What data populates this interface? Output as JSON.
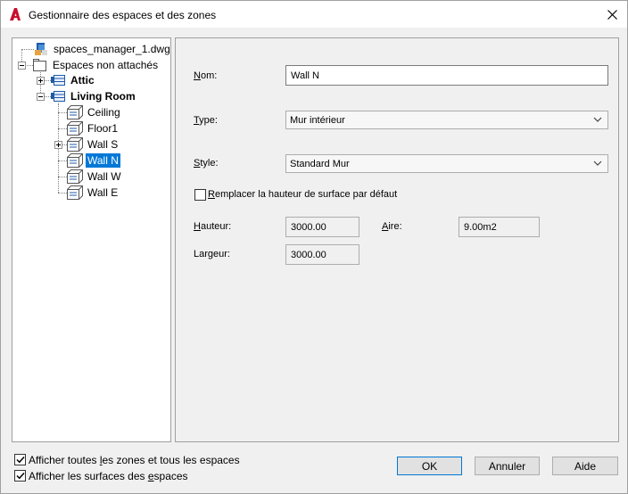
{
  "window": {
    "title": "Gestionnaire des espaces et des zones"
  },
  "tree": {
    "root": "spaces_manager_1.dwg",
    "group": "Espaces non attachés",
    "zones": [
      "Attic",
      "Living Room"
    ],
    "surfaces": [
      "Ceiling",
      "Floor1",
      "Wall S",
      "Wall N",
      "Wall W",
      "Wall E"
    ],
    "selected": "Wall N"
  },
  "form": {
    "name_label": "om:",
    "name_label_accel": "N",
    "name_value": "Wall N",
    "type_label": "ype:",
    "type_label_accel": "T",
    "type_value": "Mur intérieur",
    "style_label": "tyle:",
    "style_label_accel": "S",
    "style_value": "Standard Mur",
    "override_label": "emplacer la hauteur de surface par défaut",
    "override_label_accel": "R",
    "override_checked": false,
    "height_label": "auteur:",
    "height_label_accel": "H",
    "height_value": "3000.00",
    "area_label": "ire:",
    "area_label_accel": "A",
    "area_value": "9.00m2",
    "width_label": "Largeur:",
    "width_value": "3000.00"
  },
  "options": {
    "show_all_label_pre": "Afficher toutes ",
    "show_all_label_accel": "l",
    "show_all_label_post": "es zones et tous les espaces",
    "show_all_checked": true,
    "show_surfaces_label_pre": "Afficher les surfaces des ",
    "show_surfaces_label_accel": "e",
    "show_surfaces_label_post": "spaces",
    "show_surfaces_checked": true
  },
  "buttons": {
    "ok": "OK",
    "cancel": "Annuler",
    "help": "Aide"
  },
  "colors": {
    "accent": "#0078d7",
    "autocad_red": "#c8102e"
  }
}
